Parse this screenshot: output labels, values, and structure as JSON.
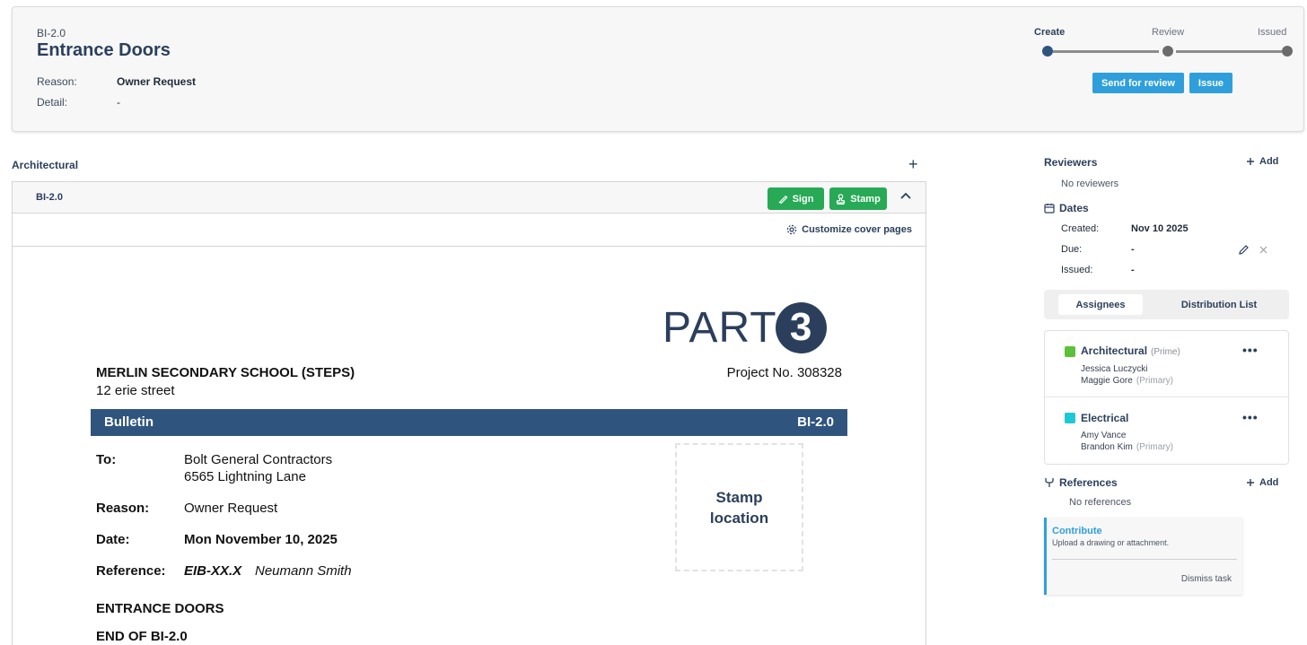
{
  "header": {
    "code": "BI-2.0",
    "title": "Entrance Doors",
    "reason_label": "Reason:",
    "reason_value": "Owner Request",
    "detail_label": "Detail:",
    "detail_value": "-",
    "steps": [
      "Create",
      "Review",
      "Issued"
    ],
    "send_review_label": "Send for review",
    "issue_label": "Issue"
  },
  "section": {
    "title": "Architectural",
    "add_symbol": "+"
  },
  "doc": {
    "bar_code": "BI-2.0",
    "sign_label": "Sign",
    "stamp_label": "Stamp",
    "customize_label": "Customize cover pages",
    "logo_text": "PART",
    "logo_digit": "3",
    "project_name": "MERLIN SECONDARY SCHOOL (STEPS)",
    "project_address": "12 erie street",
    "project_no": "Project No. 308328",
    "bulletin_label": "Bulletin",
    "bulletin_code": "BI-2.0",
    "to_label": "To:",
    "to_line1": "Bolt General Contractors",
    "to_line2": "6565 Lightning Lane",
    "reason_label": "Reason:",
    "reason_value": "Owner Request",
    "date_label": "Date:",
    "date_value": "Mon November 10, 2025",
    "reference_label": "Reference:",
    "reference_code": "EIB-XX.X",
    "reference_name": "Neumann Smith",
    "stamp_line1": "Stamp",
    "stamp_line2": "location",
    "heading": "ENTRANCE DOORS",
    "end_heading": "END OF BI-2.0"
  },
  "sidebar": {
    "reviewers_title": "Reviewers",
    "add_label": "Add",
    "no_reviewers": "No reviewers",
    "dates_title": "Dates",
    "created_label": "Created:",
    "created_value": "Nov 10 2025",
    "due_label": "Due:",
    "due_value": "-",
    "issued_label": "Issued:",
    "issued_value": "-",
    "tabs": [
      "Assignees",
      "Distribution List"
    ],
    "assignees": [
      {
        "name": "Architectural",
        "tag": "(Prime)",
        "color": "#5cc13a",
        "people": [
          {
            "name": "Jessica Luczycki",
            "tag": ""
          },
          {
            "name": "Maggie Gore",
            "tag": "(Primary)"
          }
        ]
      },
      {
        "name": "Electrical",
        "tag": "",
        "color": "#1ec8d6",
        "people": [
          {
            "name": "Amy Vance",
            "tag": ""
          },
          {
            "name": "Brandon Kim",
            "tag": "(Primary)"
          }
        ]
      }
    ],
    "more_symbol": "•••",
    "references_title": "References",
    "no_references": "No references",
    "contribute_title": "Contribute",
    "contribute_desc": "Upload a drawing or attachment.",
    "dismiss_label": "Dismiss task"
  },
  "colors": {
    "primary_navy": "#2b3f5c",
    "bulletin_blue": "#2f557f",
    "action_blue": "#2f9fdc",
    "action_green": "#27a956"
  }
}
